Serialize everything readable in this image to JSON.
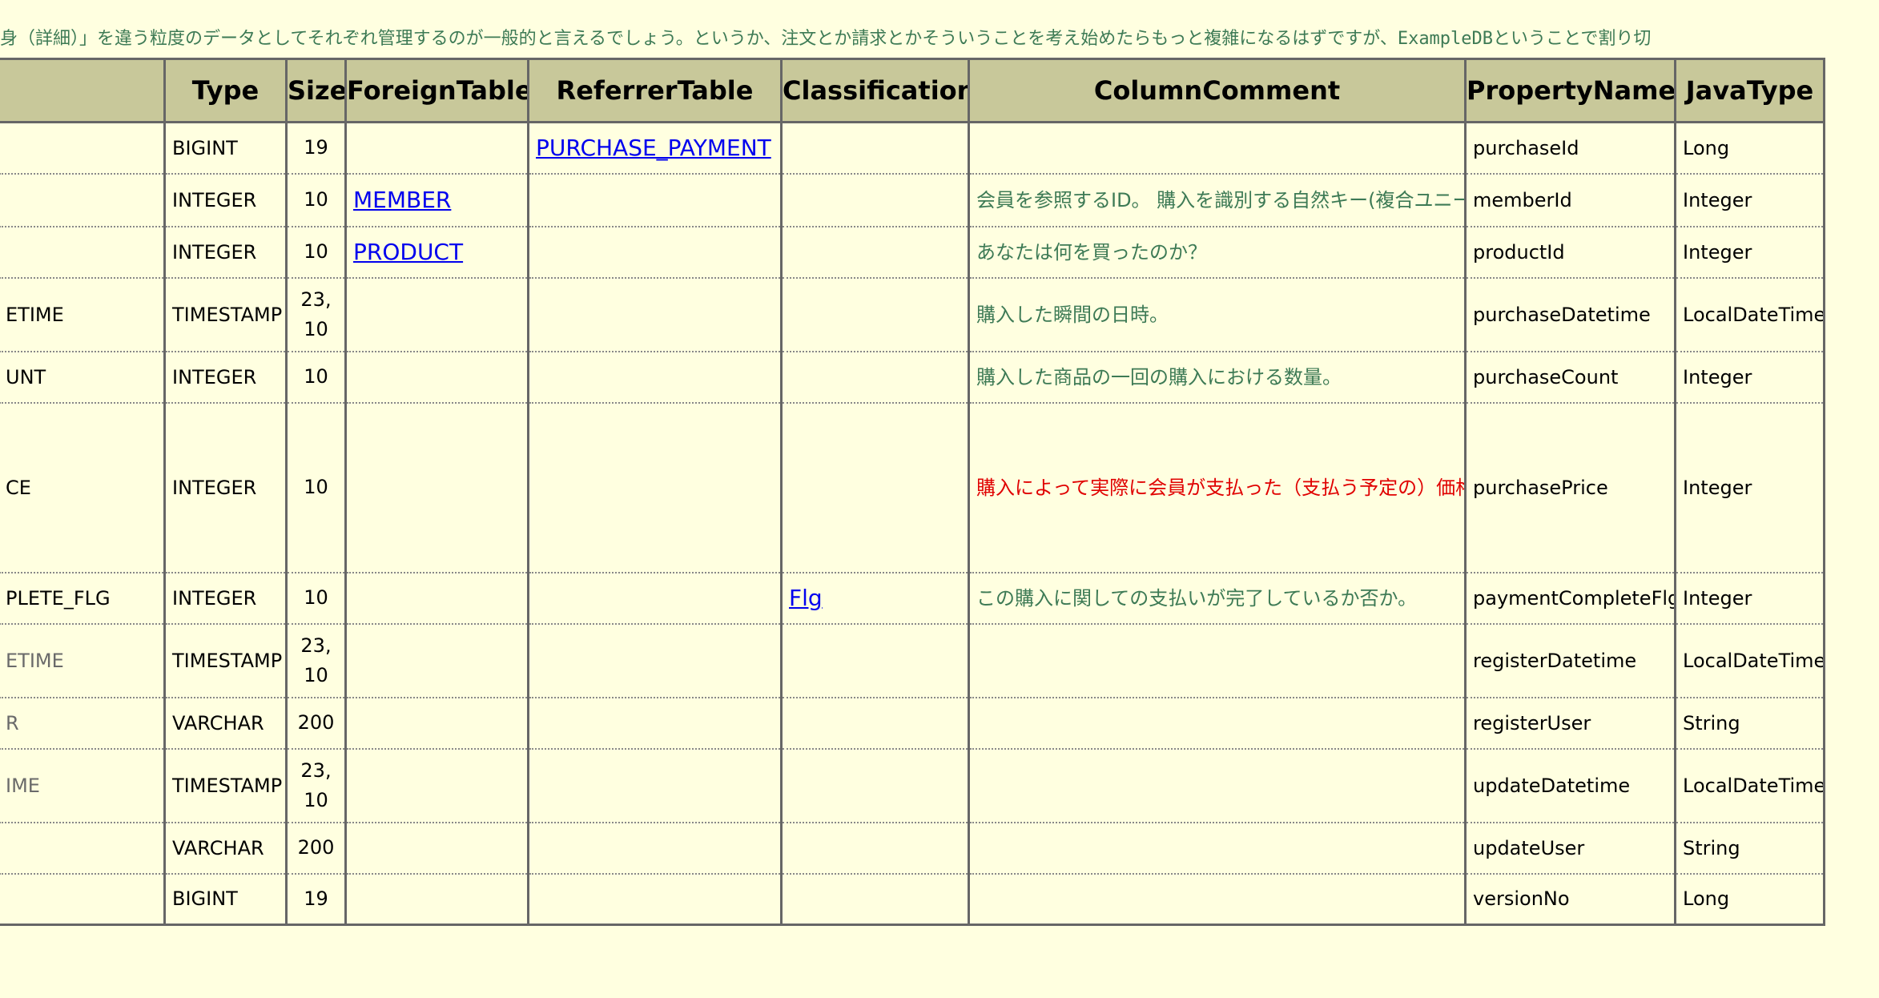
{
  "intro_text": "身（詳細）」を違う粒度のデータとしてそれぞれ管理するのが一般的と言えるでしょう。というか、注文とか請求とかそういうことを考え始めたらもっと複雑になるはずですが、ExampleDBということで割り切",
  "headers": [
    "",
    "Type",
    "Size",
    "ForeignTable",
    "ReferrerTable",
    "Classification",
    "ColumnComment",
    "PropertyName",
    "JavaType"
  ],
  "rows": [
    {
      "name": "",
      "type": "BIGINT",
      "size": "19",
      "foreign": "",
      "referrer": "PURCHASE_PAYMENT",
      "classification": "",
      "comment": "",
      "property": "purchaseId",
      "java": "Long"
    },
    {
      "name": "",
      "type": "INTEGER",
      "size": "10",
      "foreign": "MEMBER",
      "referrer": "",
      "classification": "",
      "comment": "会員を参照するID。\n購入を識別する自然キー(複合ユニーク制約)の筆頭要素。",
      "property": "memberId",
      "java": "Integer"
    },
    {
      "name": "",
      "type": "INTEGER",
      "size": "10",
      "foreign": "PRODUCT",
      "referrer": "",
      "classification": "",
      "comment": "あなたは何を買ったのか？",
      "property": "productId",
      "java": "Integer"
    },
    {
      "name": "ETIME",
      "type": "TIMESTAMP",
      "size": "23,\n10",
      "foreign": "",
      "referrer": "",
      "classification": "",
      "comment": "購入した瞬間の日時。",
      "property": "purchaseDatetime",
      "java": "LocalDateTime"
    },
    {
      "name": "UNT",
      "type": "INTEGER",
      "size": "10",
      "foreign": "",
      "referrer": "",
      "classification": "",
      "comment": "購入した商品の一回の購入における数量。",
      "property": "purchaseCount",
      "java": "Integer"
    },
    {
      "name": "CE",
      "type": "INTEGER",
      "size": "10",
      "foreign": "",
      "referrer": "",
      "classification": "",
      "comment": "購入によって実際に会員が支払った（支払う予定の）価格。\nさあ、ここでコンフリクトさせるぞ！\n\n=======\n\n購入によって実際に会員が支払った（支払う予定の）価格。\nでもって、こっちも修正すればめでたくコンフリクトのはず。\n@author(jflute)",
      "property": "purchasePrice",
      "java": "Integer"
    },
    {
      "name": "PLETE_FLG",
      "type": "INTEGER",
      "size": "10",
      "foreign": "",
      "referrer": "",
      "classification": "Flg",
      "comment": "この購入に関しての支払いが完了しているか否か。",
      "property": "paymentCompleteFlg",
      "java": "Integer"
    },
    {
      "name": "ETIME",
      "type": "TIMESTAMP",
      "size": "23,\n10",
      "foreign": "",
      "referrer": "",
      "classification": "",
      "comment": "",
      "property": "registerDatetime",
      "java": "LocalDateTime"
    },
    {
      "name": "R",
      "type": "VARCHAR",
      "size": "200",
      "foreign": "",
      "referrer": "",
      "classification": "",
      "comment": "",
      "property": "registerUser",
      "java": "String"
    },
    {
      "name": "IME",
      "type": "TIMESTAMP",
      "size": "23,\n10",
      "foreign": "",
      "referrer": "",
      "classification": "",
      "comment": "",
      "property": "updateDatetime",
      "java": "LocalDateTime"
    },
    {
      "name": "",
      "type": "VARCHAR",
      "size": "200",
      "foreign": "",
      "referrer": "",
      "classification": "",
      "comment": "",
      "property": "updateUser",
      "java": "String"
    },
    {
      "name": "",
      "type": "BIGINT",
      "size": "19",
      "foreign": "",
      "referrer": "",
      "classification": "",
      "comment": "",
      "property": "versionNo",
      "java": "Long"
    }
  ],
  "colors": {
    "background": "#ffffe0",
    "header_bg": "#c8c89a",
    "comment": "#3d7a55",
    "alert_comment": "#e00000",
    "link": "#0000ee"
  }
}
